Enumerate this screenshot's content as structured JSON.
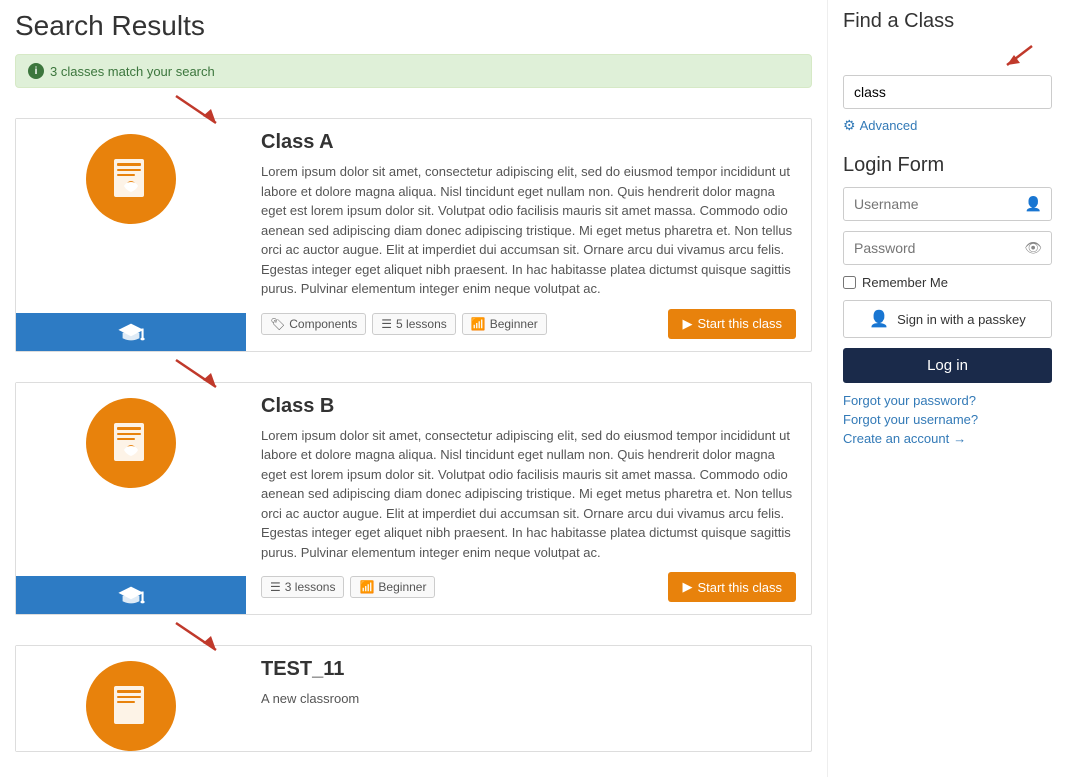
{
  "page": {
    "title": "Search Results"
  },
  "search_info": {
    "message": "3 classes match your search"
  },
  "classes": [
    {
      "id": "class-a",
      "title": "Class A",
      "description": "Lorem ipsum dolor sit amet, consectetur adipiscing elit, sed do eiusmod tempor incididunt ut labore et dolore magna aliqua. Nisl tincidunt eget nullam non. Quis hendrerit dolor magna eget est lorem ipsum dolor sit. Volutpat odio facilisis mauris sit amet massa. Commodo odio aenean sed adipiscing diam donec adipiscing tristique. Mi eget metus pharetra et. Non tellus orci ac auctor augue. Elit at imperdiet dui accumsan sit. Ornare arcu dui vivamus arcu felis. Egestas integer eget aliquet nibh praesent. In hac habitasse platea dictumst quisque sagittis purus. Pulvinar elementum integer enim neque volutpat ac.",
      "badges": [
        "Components",
        "5 lessons",
        "Beginner"
      ],
      "badge_icons": [
        "tag",
        "list",
        "bar"
      ],
      "start_label": "Start this class"
    },
    {
      "id": "class-b",
      "title": "Class B",
      "description": "Lorem ipsum dolor sit amet, consectetur adipiscing elit, sed do eiusmod tempor incididunt ut labore et dolore magna aliqua. Nisl tincidunt eget nullam non. Quis hendrerit dolor magna eget est lorem ipsum dolor sit. Volutpat odio facilisis mauris sit amet massa. Commodo odio aenean sed adipiscing diam donec adipiscing tristique. Mi eget metus pharetra et. Non tellus orci ac auctor augue. Elit at imperdiet dui accumsan sit. Ornare arcu dui vivamus arcu felis. Egestas integer eget aliquet nibh praesent. In hac habitasse platea dictumst quisque sagittis purus. Pulvinar elementum integer enim neque volutpat ac.",
      "badges": [
        "3 lessons",
        "Beginner"
      ],
      "badge_icons": [
        "list",
        "bar"
      ],
      "start_label": "Start this class"
    },
    {
      "id": "test-11",
      "title": "TEST_11",
      "description": "A new classroom",
      "badges": [],
      "badge_icons": [],
      "start_label": ""
    }
  ],
  "sidebar": {
    "find_class": {
      "title": "Find a Class",
      "search_value": "class",
      "search_placeholder": "class",
      "advanced_label": "Advanced"
    },
    "login_form": {
      "title": "Login Form",
      "username_placeholder": "Username",
      "password_placeholder": "Password",
      "remember_label": "Remember Me",
      "passkey_label": "Sign in with a passkey",
      "login_label": "Log in",
      "forgot_password": "Forgot your password?",
      "forgot_username": "Forgot your username?",
      "create_account": "Create an account"
    }
  }
}
